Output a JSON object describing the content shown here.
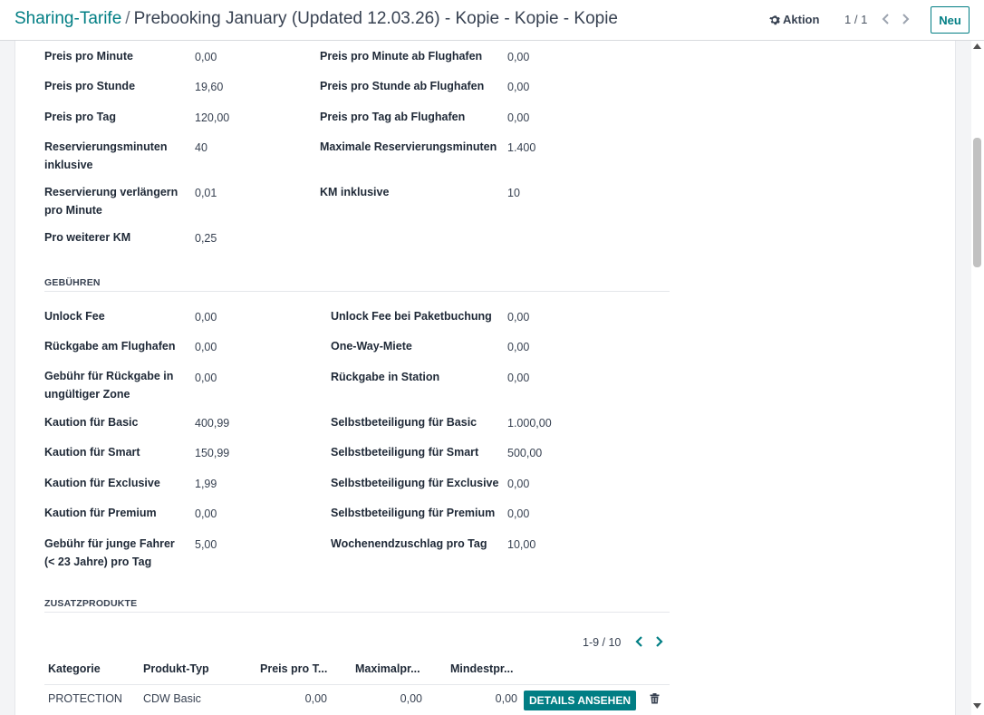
{
  "header": {
    "breadcrumb_root": "Sharing-Tarife",
    "breadcrumb_sep": "/",
    "breadcrumb_current": "Prebooking January (Updated 12.03.26) - Kopie - Kopie - Kopie",
    "action_label": "Aktion",
    "pager": "1 / 1",
    "new_label": "Neu"
  },
  "pricing": {
    "left": [
      {
        "label_1": "Preis pro Minute",
        "label_2": "",
        "value": "0,00"
      },
      {
        "label_1": "Preis pro Stunde",
        "label_2": "",
        "value": "19,60"
      },
      {
        "label_1": "Preis pro Tag",
        "label_2": "",
        "value": "120,00"
      },
      {
        "label_1": "Reservierungsminuten",
        "label_2": "inklusive",
        "value": "40"
      },
      {
        "label_1": "Reservierung verlängern",
        "label_2": "pro Minute",
        "value": "0,01"
      },
      {
        "label_1": "Pro weiterer KM",
        "label_2": "",
        "value": "0,25"
      }
    ],
    "right": [
      {
        "label": "Preis pro Minute ab Flughafen",
        "value": "0,00"
      },
      {
        "label": "Preis pro Stunde ab Flughafen",
        "value": "0,00"
      },
      {
        "label": "Preis pro Tag ab Flughafen",
        "value": "0,00"
      },
      {
        "label": "Maximale Reservierungsminuten",
        "value": "1.400"
      },
      {
        "label": "KM inklusive",
        "value": "10"
      }
    ]
  },
  "fees": {
    "title": "GEBÜHREN",
    "left": [
      {
        "label_1": "Unlock Fee",
        "label_2": "",
        "value": "0,00"
      },
      {
        "label_1": "Rückgabe am Flughafen",
        "label_2": "",
        "value": "0,00"
      },
      {
        "label_1": "Gebühr für Rückgabe in",
        "label_2": "ungültiger Zone",
        "value": "0,00"
      },
      {
        "label_1": "Kaution für Basic",
        "label_2": "",
        "value": "400,99"
      },
      {
        "label_1": "Kaution für Smart",
        "label_2": "",
        "value": "150,99"
      },
      {
        "label_1": "Kaution für Exclusive",
        "label_2": "",
        "value": "1,99"
      },
      {
        "label_1": "Kaution für Premium",
        "label_2": "",
        "value": "0,00"
      },
      {
        "label_1": "Gebühr für junge Fahrer",
        "label_2": "(< 23 Jahre) pro Tag",
        "value": "5,00"
      }
    ],
    "right": [
      {
        "label": "Unlock Fee bei Paketbuchung",
        "value": "0,00"
      },
      {
        "label": "One-Way-Miete",
        "value": "0,00"
      },
      {
        "label": "Rückgabe in Station",
        "value": "0,00"
      },
      {
        "label": "Selbstbeteiligung für Basic",
        "value": "1.000,00"
      },
      {
        "label": "Selbstbeteiligung für Smart",
        "value": "500,00"
      },
      {
        "label": "Selbstbeteiligung für Exclusive",
        "value": "0,00"
      },
      {
        "label": "Selbstbeteiligung für Premium",
        "value": "0,00"
      },
      {
        "label": "Wochenendzuschlag pro Tag",
        "value": "10,00"
      }
    ]
  },
  "products": {
    "title": "ZUSATZPRODUKTE",
    "pager": "1-9 / 10",
    "columns": [
      "Kategorie",
      "Produkt-Typ",
      "Preis pro T...",
      "Maximalpr...",
      "Mindestpr..."
    ],
    "row": {
      "kategorie": "PROTECTION",
      "typ": "CDW Basic",
      "preis": "0,00",
      "max": "0,00",
      "min": "0,00",
      "button": "DETAILS ANSEHEN"
    }
  },
  "icons": {
    "action": "gear-icon",
    "prev": "chevron-left-icon",
    "next": "chevron-right-icon",
    "delete": "trash-icon"
  },
  "colors": {
    "accent": "#017e84"
  }
}
